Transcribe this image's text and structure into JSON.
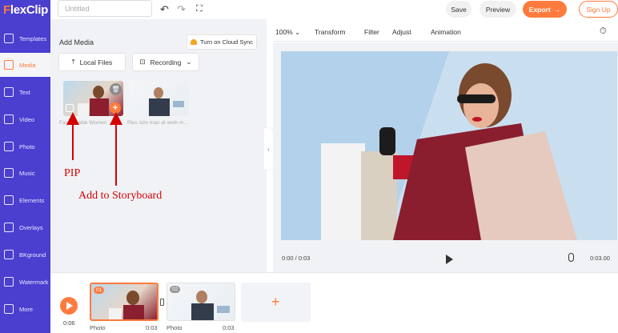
{
  "app": {
    "logo_prefix": "F",
    "logo_rest": "lexClip",
    "project_title_placeholder": "Untitled"
  },
  "topbar": {
    "undo_icon": "undo-icon",
    "redo_icon": "redo-icon",
    "fullscreen_icon": "fullscreen-icon",
    "save_label": "Save",
    "preview_label": "Preview",
    "export_label": "Export",
    "signup_label": "Sign Up"
  },
  "sidebar": {
    "items": [
      {
        "label": "Templates",
        "icon": "templates-icon"
      },
      {
        "label": "Media",
        "icon": "media-icon"
      },
      {
        "label": "Text",
        "icon": "text-icon"
      },
      {
        "label": "Video",
        "icon": "video-icon"
      },
      {
        "label": "Photo",
        "icon": "photo-icon"
      },
      {
        "label": "Music",
        "icon": "music-icon"
      },
      {
        "label": "Elements",
        "icon": "elements-icon"
      },
      {
        "label": "Overlays",
        "icon": "overlays-icon"
      },
      {
        "label": "BKground",
        "icon": "background-icon"
      },
      {
        "label": "Watermark",
        "icon": "watermark-icon"
      },
      {
        "label": "More",
        "icon": "more-icon"
      }
    ]
  },
  "media_panel": {
    "title": "Add Media",
    "cloud_sync_label": "Turn on Cloud Sync",
    "local_files_label": "Local Files",
    "recording_label": "Recording",
    "items": [
      {
        "caption": "Fashionable Women"
      },
      {
        "caption": "Plus size man at work m..."
      }
    ]
  },
  "annotations": {
    "pip": "PIP",
    "add_to_storyboard": "Add to Storyboard"
  },
  "toolbar": {
    "zoom": "100%",
    "transform": "Transform",
    "filter": "Filter",
    "adjust": "Adjust",
    "animation": "Animation"
  },
  "player": {
    "current_time": "0:00 / 0:03",
    "duration": "0:03.00"
  },
  "storyboard": {
    "total_time": "0:06",
    "clips": [
      {
        "num": "01",
        "label": "Photo",
        "time": "0:03"
      },
      {
        "num": "02",
        "label": "Photo",
        "time": "0:03"
      }
    ],
    "add_symbol": "+"
  },
  "colors": {
    "sidebar": "#4a3fcf",
    "accent": "#ff7a3d",
    "annotation": "#d40000"
  }
}
